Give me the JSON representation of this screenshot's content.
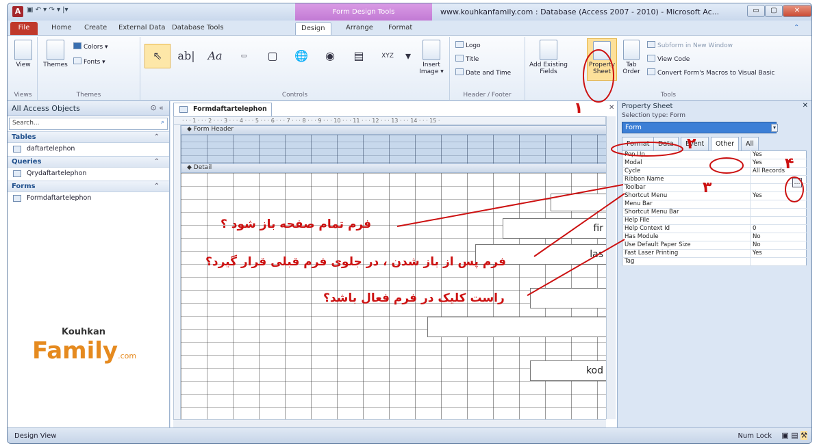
{
  "titlebar": {
    "app_letter": "A",
    "quick_access": "▣  ↶ ▾  ↷ ▾  |▾",
    "context_tab": "Form Design Tools",
    "title": "www.kouhkanfamily.com : Database (Access 2007 - 2010) - Microsoft Ac...",
    "minimize": "▭",
    "maximize": "▢",
    "close": "✕"
  },
  "tabs": [
    "File",
    "Home",
    "Create",
    "External Data",
    "Database Tools",
    "Design",
    "Arrange",
    "Format"
  ],
  "ribbon": {
    "views": {
      "view": "View",
      "group": "Views"
    },
    "themes": {
      "themes": "Themes",
      "colors": "Colors ▾",
      "fonts": "Fonts ▾",
      "group": "Themes"
    },
    "controls": {
      "group": "Controls",
      "insert_image": "Insert Image ▾"
    },
    "header_footer": {
      "logo": "Logo",
      "title": "Title",
      "date_time": "Date and Time",
      "group": "Header / Footer"
    },
    "tools": {
      "add_fields": "Add Existing Fields",
      "property_sheet": "Property Sheet",
      "tab_order": "Tab Order",
      "subform": "Subform in New Window",
      "view_code": "View Code",
      "convert": "Convert Form's Macros to Visual Basic",
      "group": "Tools"
    }
  },
  "nav": {
    "header": "All Access Objects",
    "search_placeholder": "Search...",
    "groups": [
      {
        "label": "Tables",
        "items": [
          "daftartelephon"
        ]
      },
      {
        "label": "Queries",
        "items": [
          "Qrydaftartelephon"
        ]
      },
      {
        "label": "Forms",
        "items": [
          "Formdaftartelephon"
        ]
      }
    ],
    "logo_top": "Kouhkan",
    "logo_main": "Family",
    "logo_suffix": ".com"
  },
  "document": {
    "tab": "Formdaftartelephon",
    "ruler": "· · · 1 · · · 2 · · · 3 · · · 4 · · · 5 · · · 6 · · · 7 · · · 8 · · · 9 · · · 10 · · · 11 · · · 12 · · · 13 · · · 14 · · · 15 ·",
    "form_header": "Form Header",
    "detail": "Detail",
    "controls": [
      "fir",
      "las",
      "",
      "kod"
    ]
  },
  "property_sheet": {
    "title": "Property Sheet",
    "selection_type": "Selection type:  Form",
    "combo": "Form",
    "tabs": [
      "Format",
      "Data",
      "Event",
      "Other",
      "All"
    ],
    "active_tab": "Other",
    "rows": [
      [
        "Pop Up",
        "Yes"
      ],
      [
        "Modal",
        "Yes"
      ],
      [
        "Cycle",
        "All Records"
      ],
      [
        "Ribbon Name",
        ""
      ],
      [
        "Toolbar",
        ""
      ],
      [
        "Shortcut Menu",
        "Yes"
      ],
      [
        "Menu Bar",
        ""
      ],
      [
        "Shortcut Menu Bar",
        ""
      ],
      [
        "Help File",
        ""
      ],
      [
        "Help Context Id",
        "0"
      ],
      [
        "Has Module",
        "No"
      ],
      [
        "Use Default Paper Size",
        "No"
      ],
      [
        "Fast Laser Printing",
        "Yes"
      ],
      [
        "Tag",
        ""
      ]
    ]
  },
  "status": {
    "left": "Design View",
    "right": "Num Lock"
  },
  "annotations": {
    "a1": "فرم تمام صفحه باز شود ؟",
    "a2": "فرم پس از باز شدن ، در جلوی فرم قبلی قرار گیرد؟",
    "a3": "راست کلیک در فرم فعال باشد؟",
    "n1": "۱",
    "n2": "۲",
    "n3": "۳",
    "n4": "۴"
  },
  "colors": {
    "accent": "#cc1111",
    "file_tab": "#c0392b",
    "context": "#c27ad4",
    "selection": "#3c7fd6"
  }
}
